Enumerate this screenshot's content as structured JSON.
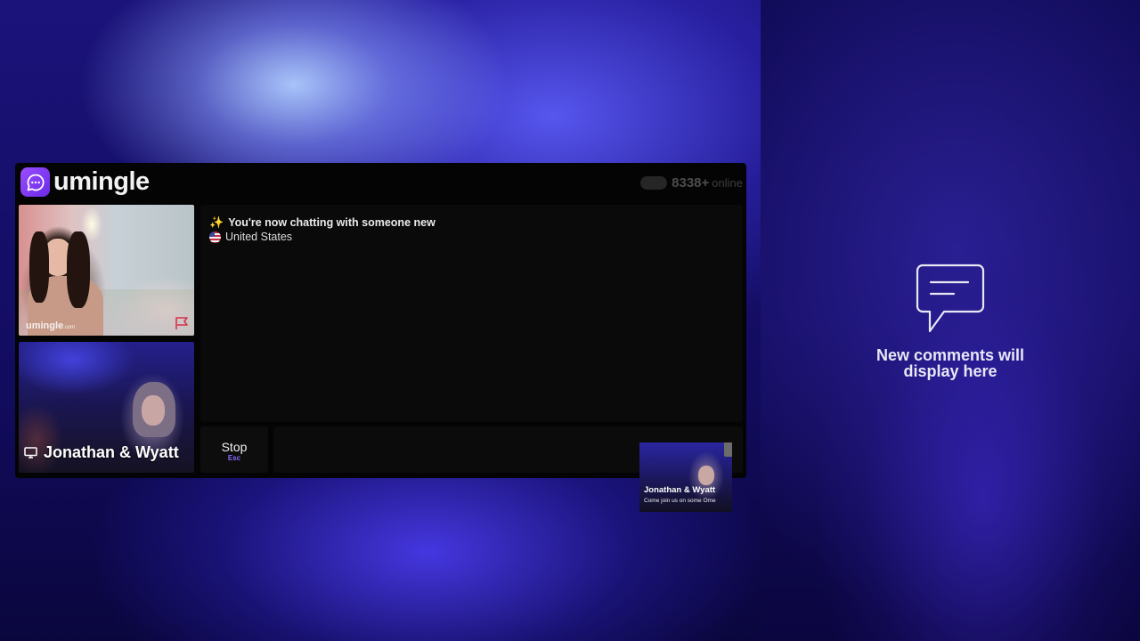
{
  "app": {
    "logo_text": "umingle",
    "online_count": "8338+",
    "online_label": "online"
  },
  "chat": {
    "system_message": "You're now chatting with someone new",
    "system_icon": "sparkles-icon",
    "country": "United States",
    "country_icon": "us-flag-icon"
  },
  "videos": {
    "stranger_watermark": "umingle",
    "stranger_watermark_suffix": ".com",
    "self_caption": "Jonathan & Wyatt"
  },
  "controls": {
    "stop_label": "Stop",
    "stop_shortcut": "Esc",
    "message_placeholder": ""
  },
  "pip": {
    "name": "Jonathan & Wyatt",
    "subtitle": "Come join us on some Ome"
  },
  "comments": {
    "empty_message": "New comments will display here"
  },
  "colors": {
    "accent": "#8b6cff",
    "logo_purple": "#7b35f0",
    "report_flag": "#d8304a"
  }
}
